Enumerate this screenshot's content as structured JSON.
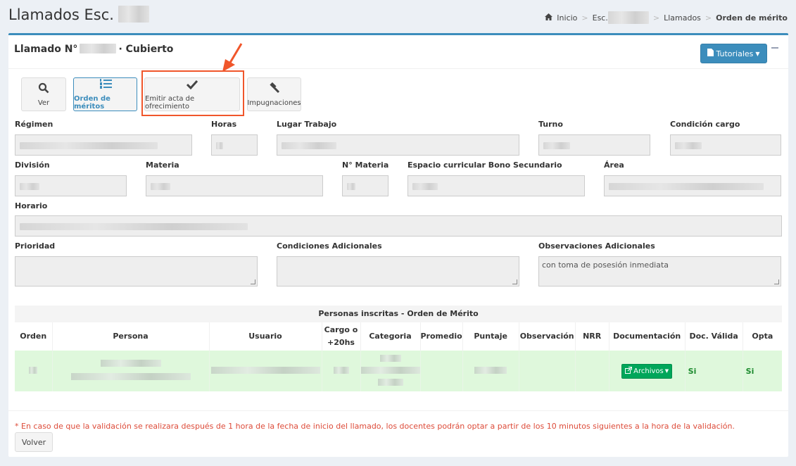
{
  "page": {
    "title": "Llamados Esc."
  },
  "breadcrumb": {
    "home": "Inicio",
    "school": "Esc.",
    "llamados": "Llamados",
    "current": "Orden de mérito"
  },
  "box": {
    "title_prefix": "Llamado N°",
    "title_suffix": "· Cubierto",
    "tutoriales_label": "Tutoriales"
  },
  "toolbar": {
    "ver": "Ver",
    "orden": "Orden de méritos",
    "emitir": "Emitir acta de ofrecimiento",
    "impugnaciones": "Impugnaciones"
  },
  "fields": {
    "regimen": "Régimen",
    "horas": "Horas",
    "lugar_trabajo": "Lugar Trabajo",
    "turno": "Turno",
    "condicion_cargo": "Condición cargo",
    "division": "División",
    "materia": "Materia",
    "n_materia": "N° Materia",
    "espacio_curricular": "Espacio curricular Bono Secundario",
    "area": "Área",
    "horario": "Horario",
    "prioridad": "Prioridad",
    "condiciones_adicionales": "Condiciones Adicionales",
    "observaciones_adicionales": "Observaciones Adicionales",
    "observaciones_value": "con toma de posesión inmediata"
  },
  "table": {
    "caption": "Personas inscritas - Orden de Mérito",
    "headers": {
      "orden": "Orden",
      "persona": "Persona",
      "usuario": "Usuario",
      "cargo_line1": "Cargo o",
      "cargo_line2": "+20hs",
      "categoria": "Categoria",
      "promedio": "Promedio",
      "puntaje": "Puntaje",
      "observacion": "Observación",
      "nrr": "NRR",
      "documentacion": "Documentación",
      "doc_valida": "Doc. Válida",
      "opta": "Opta"
    },
    "row": {
      "archivos": "Archivos",
      "doc_valida": "Si",
      "opta": "Si"
    }
  },
  "footnote": "* En caso de que la validación se realizara después de 1 hora de la fecha de inicio del llamado, los docentes podrán optar a partir de los 10 minutos siguientes a la hora de la validación.",
  "volver_label": "Volver",
  "colors": {
    "primary": "#3c8dbc",
    "success": "#00a65a",
    "highlight": "#f0562b",
    "row_bg": "#dff8dc",
    "danger_text": "#dd4b39"
  }
}
